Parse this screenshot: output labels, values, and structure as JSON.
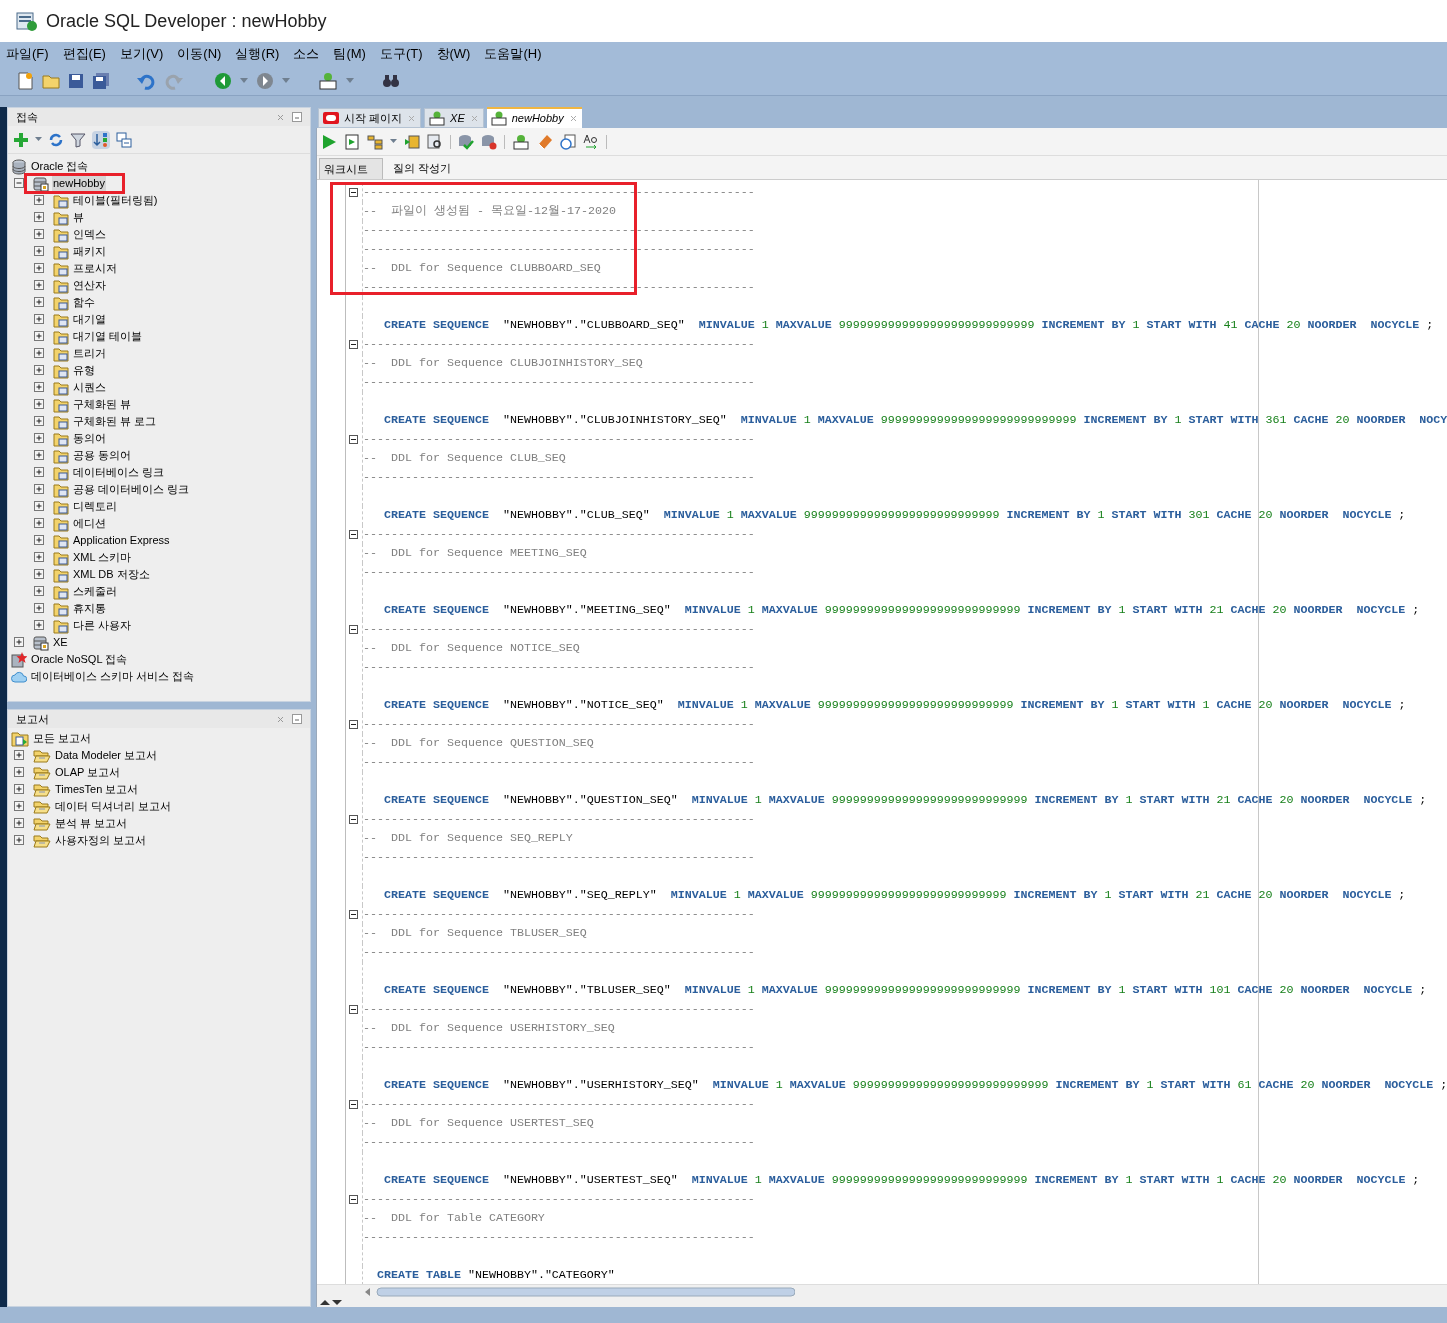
{
  "window": {
    "title": "Oracle SQL Developer : newHobby"
  },
  "menu": [
    "파일(F)",
    "편집(E)",
    "보기(V)",
    "이동(N)",
    "실행(R)",
    "소스",
    "팀(M)",
    "도구(T)",
    "창(W)",
    "도움말(H)"
  ],
  "connections_panel": {
    "title": "접속",
    "tree": [
      {
        "label": "Oracle 접속",
        "kind": "database",
        "selected": false,
        "children": [
          {
            "label": "newHobby",
            "expanded": true,
            "selected": true,
            "children": [
              {
                "label": "테이블(필터링됨)",
                "expanded": false,
                "selected": false
              },
              {
                "label": "뷰",
                "expanded": false,
                "selected": false
              },
              {
                "label": "인덱스",
                "expanded": false,
                "selected": false
              },
              {
                "label": "패키지",
                "expanded": false,
                "selected": false
              },
              {
                "label": "프로시저",
                "expanded": false,
                "selected": false
              },
              {
                "label": "연산자",
                "expanded": false,
                "selected": false
              },
              {
                "label": "함수",
                "expanded": false,
                "selected": false
              },
              {
                "label": "대기열",
                "expanded": false,
                "selected": false
              },
              {
                "label": "대기열 테이블",
                "expanded": false,
                "selected": false
              },
              {
                "label": "트리거",
                "expanded": false,
                "selected": false
              },
              {
                "label": "유형",
                "expanded": false,
                "selected": false
              },
              {
                "label": "시퀀스",
                "expanded": false,
                "selected": false
              },
              {
                "label": "구체화된 뷰",
                "expanded": false,
                "selected": false
              },
              {
                "label": "구체화된 뷰 로그",
                "expanded": false,
                "selected": false
              },
              {
                "label": "동의어",
                "expanded": false,
                "selected": false
              },
              {
                "label": "공용 동의어",
                "expanded": false,
                "selected": false
              },
              {
                "label": "데이터베이스 링크",
                "expanded": false,
                "selected": false
              },
              {
                "label": "공용 데이터베이스 링크",
                "expanded": false,
                "selected": false
              },
              {
                "label": "디렉토리",
                "expanded": false,
                "selected": false
              },
              {
                "label": "에디션",
                "expanded": false,
                "selected": false
              },
              {
                "label": "Application Express",
                "expanded": false,
                "selected": false
              },
              {
                "label": "XML 스키마",
                "expanded": false,
                "selected": false
              },
              {
                "label": "XML DB 저장소",
                "expanded": false,
                "selected": false
              },
              {
                "label": "스케줄러",
                "expanded": false,
                "selected": false
              },
              {
                "label": "휴지통",
                "expanded": false,
                "selected": false
              },
              {
                "label": "다른 사용자",
                "expanded": false,
                "selected": false
              }
            ]
          },
          {
            "label": "XE",
            "expanded": false,
            "selected": false
          }
        ]
      },
      {
        "label": "Oracle NoSQL 접속",
        "kind": "nosql",
        "selected": false
      },
      {
        "label": "데이터베이스 스키마 서비스 접속",
        "kind": "cloud",
        "selected": false
      }
    ]
  },
  "reports_panel": {
    "title": "보고서",
    "tree": [
      {
        "label": "모든 보고서",
        "kind": "reports",
        "selected": false,
        "children": [
          {
            "label": "Data Modeler 보고서",
            "expanded": false,
            "selected": false
          },
          {
            "label": "OLAP 보고서",
            "expanded": false,
            "selected": false
          },
          {
            "label": "TimesTen 보고서",
            "expanded": false,
            "selected": false
          },
          {
            "label": "데이터 딕셔너리 보고서",
            "expanded": false,
            "selected": false
          },
          {
            "label": "분석 뷰 보고서",
            "expanded": false,
            "selected": false
          },
          {
            "label": "사용자정의 보고서",
            "expanded": false,
            "selected": false
          }
        ]
      }
    ]
  },
  "editor": {
    "tabs": [
      {
        "label": "시작 페이지",
        "kind": "start",
        "selected": false
      },
      {
        "label": "XE",
        "kind": "worksheet",
        "selected": false
      },
      {
        "label": "newHobby",
        "kind": "worksheet",
        "selected": true
      }
    ],
    "subtabs": [
      {
        "label": "워크시트",
        "selected": true
      },
      {
        "label": "질의 작성기",
        "selected": false
      }
    ],
    "lines": [
      {
        "kind": "rule",
        "text": "--------------------------------------------------------",
        "fold_expanded": true
      },
      {
        "kind": "comment",
        "text": "--  파일이 생성됨 - 목요일-12월-17-2020"
      },
      {
        "kind": "rule",
        "text": "--------------------------------------------------------"
      },
      {
        "kind": "rule",
        "text": "--------------------------------------------------------"
      },
      {
        "kind": "comment",
        "text": "--  DDL for Sequence CLUBBOARD_SEQ"
      },
      {
        "kind": "rule",
        "text": "--------------------------------------------------------"
      },
      {
        "kind": "blank"
      },
      {
        "kind": "code",
        "tokens": [
          {
            "kind": "keyword",
            "text": "   CREATE SEQUENCE"
          },
          {
            "kind": "plain",
            "text": "  \"NEWHOBBY\".\"CLUBBOARD_SEQ\"  "
          },
          {
            "kind": "keyword",
            "text": "MINVALUE"
          },
          {
            "kind": "number",
            "text": " 1 "
          },
          {
            "kind": "keyword",
            "text": "MAXVALUE"
          },
          {
            "kind": "number",
            "text": " 9999999999999999999999999999 "
          },
          {
            "kind": "keyword",
            "text": "INCREMENT BY"
          },
          {
            "kind": "number",
            "text": " 1 "
          },
          {
            "kind": "keyword",
            "text": "START WITH"
          },
          {
            "kind": "number",
            "text": " 41 "
          },
          {
            "kind": "keyword",
            "text": "CACHE"
          },
          {
            "kind": "number",
            "text": " 20 "
          },
          {
            "kind": "keyword",
            "text": "NOORDER  NOCYCLE"
          },
          {
            "kind": "plain",
            "text": " ;"
          }
        ]
      },
      {
        "kind": "rule",
        "text": "--------------------------------------------------------",
        "fold_expanded": true
      },
      {
        "kind": "comment",
        "text": "--  DDL for Sequence CLUBJOINHISTORY_SEQ"
      },
      {
        "kind": "rule",
        "text": "--------------------------------------------------------"
      },
      {
        "kind": "blank"
      },
      {
        "kind": "code",
        "tokens": [
          {
            "kind": "keyword",
            "text": "   CREATE SEQUENCE"
          },
          {
            "kind": "plain",
            "text": "  \"NEWHOBBY\".\"CLUBJOINHISTORY_SEQ\"  "
          },
          {
            "kind": "keyword",
            "text": "MINVALUE"
          },
          {
            "kind": "number",
            "text": " 1 "
          },
          {
            "kind": "keyword",
            "text": "MAXVALUE"
          },
          {
            "kind": "number",
            "text": " 9999999999999999999999999999 "
          },
          {
            "kind": "keyword",
            "text": "INCREMENT BY"
          },
          {
            "kind": "number",
            "text": " 1 "
          },
          {
            "kind": "keyword",
            "text": "START WITH"
          },
          {
            "kind": "number",
            "text": " 361 "
          },
          {
            "kind": "keyword",
            "text": "CACHE"
          },
          {
            "kind": "number",
            "text": " 20 "
          },
          {
            "kind": "keyword",
            "text": "NOORDER  NOCY"
          }
        ]
      },
      {
        "kind": "rule",
        "text": "--------------------------------------------------------",
        "fold_expanded": true
      },
      {
        "kind": "comment",
        "text": "--  DDL for Sequence CLUB_SEQ"
      },
      {
        "kind": "rule",
        "text": "--------------------------------------------------------"
      },
      {
        "kind": "blank"
      },
      {
        "kind": "code",
        "tokens": [
          {
            "kind": "keyword",
            "text": "   CREATE SEQUENCE"
          },
          {
            "kind": "plain",
            "text": "  \"NEWHOBBY\".\"CLUB_SEQ\"  "
          },
          {
            "kind": "keyword",
            "text": "MINVALUE"
          },
          {
            "kind": "number",
            "text": " 1 "
          },
          {
            "kind": "keyword",
            "text": "MAXVALUE"
          },
          {
            "kind": "number",
            "text": " 9999999999999999999999999999 "
          },
          {
            "kind": "keyword",
            "text": "INCREMENT BY"
          },
          {
            "kind": "number",
            "text": " 1 "
          },
          {
            "kind": "keyword",
            "text": "START WITH"
          },
          {
            "kind": "number",
            "text": " 301 "
          },
          {
            "kind": "keyword",
            "text": "CACHE"
          },
          {
            "kind": "number",
            "text": " 20 "
          },
          {
            "kind": "keyword",
            "text": "NOORDER  NOCYCLE"
          },
          {
            "kind": "plain",
            "text": " ;"
          }
        ]
      },
      {
        "kind": "rule",
        "text": "--------------------------------------------------------",
        "fold_expanded": true
      },
      {
        "kind": "comment",
        "text": "--  DDL for Sequence MEETING_SEQ"
      },
      {
        "kind": "rule",
        "text": "--------------------------------------------------------"
      },
      {
        "kind": "blank"
      },
      {
        "kind": "code",
        "tokens": [
          {
            "kind": "keyword",
            "text": "   CREATE SEQUENCE"
          },
          {
            "kind": "plain",
            "text": "  \"NEWHOBBY\".\"MEETING_SEQ\"  "
          },
          {
            "kind": "keyword",
            "text": "MINVALUE"
          },
          {
            "kind": "number",
            "text": " 1 "
          },
          {
            "kind": "keyword",
            "text": "MAXVALUE"
          },
          {
            "kind": "number",
            "text": " 9999999999999999999999999999 "
          },
          {
            "kind": "keyword",
            "text": "INCREMENT BY"
          },
          {
            "kind": "number",
            "text": " 1 "
          },
          {
            "kind": "keyword",
            "text": "START WITH"
          },
          {
            "kind": "number",
            "text": " 21 "
          },
          {
            "kind": "keyword",
            "text": "CACHE"
          },
          {
            "kind": "number",
            "text": " 20 "
          },
          {
            "kind": "keyword",
            "text": "NOORDER  NOCYCLE"
          },
          {
            "kind": "plain",
            "text": " ;"
          }
        ]
      },
      {
        "kind": "rule",
        "text": "--------------------------------------------------------",
        "fold_expanded": true
      },
      {
        "kind": "comment",
        "text": "--  DDL for Sequence NOTICE_SEQ"
      },
      {
        "kind": "rule",
        "text": "--------------------------------------------------------"
      },
      {
        "kind": "blank"
      },
      {
        "kind": "code",
        "tokens": [
          {
            "kind": "keyword",
            "text": "   CREATE SEQUENCE"
          },
          {
            "kind": "plain",
            "text": "  \"NEWHOBBY\".\"NOTICE_SEQ\"  "
          },
          {
            "kind": "keyword",
            "text": "MINVALUE"
          },
          {
            "kind": "number",
            "text": " 1 "
          },
          {
            "kind": "keyword",
            "text": "MAXVALUE"
          },
          {
            "kind": "number",
            "text": " 9999999999999999999999999999 "
          },
          {
            "kind": "keyword",
            "text": "INCREMENT BY"
          },
          {
            "kind": "number",
            "text": " 1 "
          },
          {
            "kind": "keyword",
            "text": "START WITH"
          },
          {
            "kind": "number",
            "text": " 1 "
          },
          {
            "kind": "keyword",
            "text": "CACHE"
          },
          {
            "kind": "number",
            "text": " 20 "
          },
          {
            "kind": "keyword",
            "text": "NOORDER  NOCYCLE"
          },
          {
            "kind": "plain",
            "text": " ;"
          }
        ]
      },
      {
        "kind": "rule",
        "text": "--------------------------------------------------------",
        "fold_expanded": true
      },
      {
        "kind": "comment",
        "text": "--  DDL for Sequence QUESTION_SEQ"
      },
      {
        "kind": "rule",
        "text": "--------------------------------------------------------"
      },
      {
        "kind": "blank"
      },
      {
        "kind": "code",
        "tokens": [
          {
            "kind": "keyword",
            "text": "   CREATE SEQUENCE"
          },
          {
            "kind": "plain",
            "text": "  \"NEWHOBBY\".\"QUESTION_SEQ\"  "
          },
          {
            "kind": "keyword",
            "text": "MINVALUE"
          },
          {
            "kind": "number",
            "text": " 1 "
          },
          {
            "kind": "keyword",
            "text": "MAXVALUE"
          },
          {
            "kind": "number",
            "text": " 9999999999999999999999999999 "
          },
          {
            "kind": "keyword",
            "text": "INCREMENT BY"
          },
          {
            "kind": "number",
            "text": " 1 "
          },
          {
            "kind": "keyword",
            "text": "START WITH"
          },
          {
            "kind": "number",
            "text": " 21 "
          },
          {
            "kind": "keyword",
            "text": "CACHE"
          },
          {
            "kind": "number",
            "text": " 20 "
          },
          {
            "kind": "keyword",
            "text": "NOORDER  NOCYCLE"
          },
          {
            "kind": "plain",
            "text": " ;"
          }
        ]
      },
      {
        "kind": "rule",
        "text": "--------------------------------------------------------",
        "fold_expanded": true
      },
      {
        "kind": "comment",
        "text": "--  DDL for Sequence SEQ_REPLY"
      },
      {
        "kind": "rule",
        "text": "--------------------------------------------------------"
      },
      {
        "kind": "blank"
      },
      {
        "kind": "code",
        "tokens": [
          {
            "kind": "keyword",
            "text": "   CREATE SEQUENCE"
          },
          {
            "kind": "plain",
            "text": "  \"NEWHOBBY\".\"SEQ_REPLY\"  "
          },
          {
            "kind": "keyword",
            "text": "MINVALUE"
          },
          {
            "kind": "number",
            "text": " 1 "
          },
          {
            "kind": "keyword",
            "text": "MAXVALUE"
          },
          {
            "kind": "number",
            "text": " 9999999999999999999999999999 "
          },
          {
            "kind": "keyword",
            "text": "INCREMENT BY"
          },
          {
            "kind": "number",
            "text": " 1 "
          },
          {
            "kind": "keyword",
            "text": "START WITH"
          },
          {
            "kind": "number",
            "text": " 21 "
          },
          {
            "kind": "keyword",
            "text": "CACHE"
          },
          {
            "kind": "number",
            "text": " 20 "
          },
          {
            "kind": "keyword",
            "text": "NOORDER  NOCYCLE"
          },
          {
            "kind": "plain",
            "text": " ;"
          }
        ]
      },
      {
        "kind": "rule",
        "text": "--------------------------------------------------------",
        "fold_expanded": true
      },
      {
        "kind": "comment",
        "text": "--  DDL for Sequence TBLUSER_SEQ"
      },
      {
        "kind": "rule",
        "text": "--------------------------------------------------------"
      },
      {
        "kind": "blank"
      },
      {
        "kind": "code",
        "tokens": [
          {
            "kind": "keyword",
            "text": "   CREATE SEQUENCE"
          },
          {
            "kind": "plain",
            "text": "  \"NEWHOBBY\".\"TBLUSER_SEQ\"  "
          },
          {
            "kind": "keyword",
            "text": "MINVALUE"
          },
          {
            "kind": "number",
            "text": " 1 "
          },
          {
            "kind": "keyword",
            "text": "MAXVALUE"
          },
          {
            "kind": "number",
            "text": " 9999999999999999999999999999 "
          },
          {
            "kind": "keyword",
            "text": "INCREMENT BY"
          },
          {
            "kind": "number",
            "text": " 1 "
          },
          {
            "kind": "keyword",
            "text": "START WITH"
          },
          {
            "kind": "number",
            "text": " 101 "
          },
          {
            "kind": "keyword",
            "text": "CACHE"
          },
          {
            "kind": "number",
            "text": " 20 "
          },
          {
            "kind": "keyword",
            "text": "NOORDER  NOCYCLE"
          },
          {
            "kind": "plain",
            "text": " ;"
          }
        ]
      },
      {
        "kind": "rule",
        "text": "--------------------------------------------------------",
        "fold_expanded": true
      },
      {
        "kind": "comment",
        "text": "--  DDL for Sequence USERHISTORY_SEQ"
      },
      {
        "kind": "rule",
        "text": "--------------------------------------------------------"
      },
      {
        "kind": "blank"
      },
      {
        "kind": "code",
        "tokens": [
          {
            "kind": "keyword",
            "text": "   CREATE SEQUENCE"
          },
          {
            "kind": "plain",
            "text": "  \"NEWHOBBY\".\"USERHISTORY_SEQ\"  "
          },
          {
            "kind": "keyword",
            "text": "MINVALUE"
          },
          {
            "kind": "number",
            "text": " 1 "
          },
          {
            "kind": "keyword",
            "text": "MAXVALUE"
          },
          {
            "kind": "number",
            "text": " 9999999999999999999999999999 "
          },
          {
            "kind": "keyword",
            "text": "INCREMENT BY"
          },
          {
            "kind": "number",
            "text": " 1 "
          },
          {
            "kind": "keyword",
            "text": "START WITH"
          },
          {
            "kind": "number",
            "text": " 61 "
          },
          {
            "kind": "keyword",
            "text": "CACHE"
          },
          {
            "kind": "number",
            "text": " 20 "
          },
          {
            "kind": "keyword",
            "text": "NOORDER  NOCYCLE"
          },
          {
            "kind": "plain",
            "text": " ;"
          }
        ]
      },
      {
        "kind": "rule",
        "text": "--------------------------------------------------------",
        "fold_expanded": true
      },
      {
        "kind": "comment",
        "text": "--  DDL for Sequence USERTEST_SEQ"
      },
      {
        "kind": "rule",
        "text": "--------------------------------------------------------"
      },
      {
        "kind": "blank"
      },
      {
        "kind": "code",
        "tokens": [
          {
            "kind": "keyword",
            "text": "   CREATE SEQUENCE"
          },
          {
            "kind": "plain",
            "text": "  \"NEWHOBBY\".\"USERTEST_SEQ\"  "
          },
          {
            "kind": "keyword",
            "text": "MINVALUE"
          },
          {
            "kind": "number",
            "text": " 1 "
          },
          {
            "kind": "keyword",
            "text": "MAXVALUE"
          },
          {
            "kind": "number",
            "text": " 9999999999999999999999999999 "
          },
          {
            "kind": "keyword",
            "text": "INCREMENT BY"
          },
          {
            "kind": "number",
            "text": " 1 "
          },
          {
            "kind": "keyword",
            "text": "START WITH"
          },
          {
            "kind": "number",
            "text": " 1 "
          },
          {
            "kind": "keyword",
            "text": "CACHE"
          },
          {
            "kind": "number",
            "text": " 20 "
          },
          {
            "kind": "keyword",
            "text": "NOORDER  NOCYCLE"
          },
          {
            "kind": "plain",
            "text": " ;"
          }
        ]
      },
      {
        "kind": "rule",
        "text": "--------------------------------------------------------",
        "fold_expanded": true
      },
      {
        "kind": "comment",
        "text": "--  DDL for Table CATEGORY"
      },
      {
        "kind": "rule",
        "text": "--------------------------------------------------------"
      },
      {
        "kind": "blank"
      },
      {
        "kind": "code",
        "tokens": [
          {
            "kind": "keyword",
            "text": "  CREATE TABLE"
          },
          {
            "kind": "plain",
            "text": " \"NEWHOBBY\".\"CATEGORY\""
          }
        ]
      }
    ]
  }
}
